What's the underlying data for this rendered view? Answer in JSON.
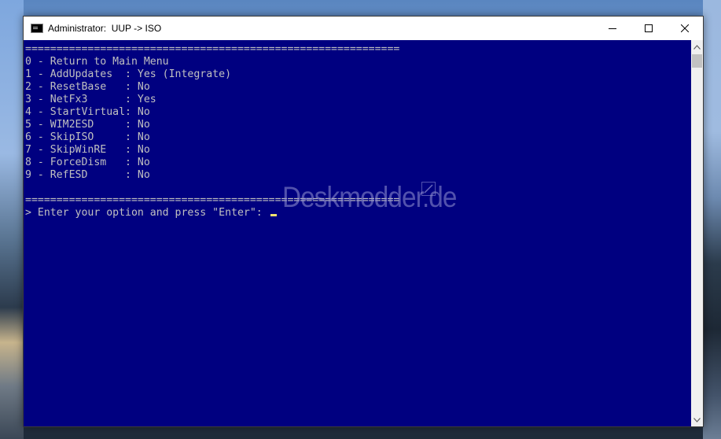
{
  "window": {
    "title": "Administrator:  UUP -> ISO",
    "icon": "cmd-icon",
    "controls": {
      "minimize": "minimize-icon",
      "maximize": "maximize-icon",
      "close": "close-icon"
    }
  },
  "console": {
    "separator_top": "============================================================",
    "lines": [
      "0 - Return to Main Menu",
      "1 - AddUpdates  : Yes (Integrate)",
      "2 - ResetBase   : No",
      "3 - NetFx3      : Yes",
      "4 - StartVirtual: No",
      "5 - WIM2ESD     : No",
      "6 - SkipISO     : No",
      "7 - SkipWinRE   : No",
      "8 - ForceDism   : No",
      "9 - RefESD      : No"
    ],
    "blank": "",
    "separator_bottom": "============================================================",
    "prompt": "> Enter your option and press \"Enter\": "
  },
  "watermark": {
    "text": "Deskmodder.de",
    "icon": "pencil-icon"
  },
  "colors": {
    "console_bg": "#000080",
    "console_text": "#c0c0c0",
    "cursor": "#f0e270",
    "titlebar": "#ffffff"
  }
}
